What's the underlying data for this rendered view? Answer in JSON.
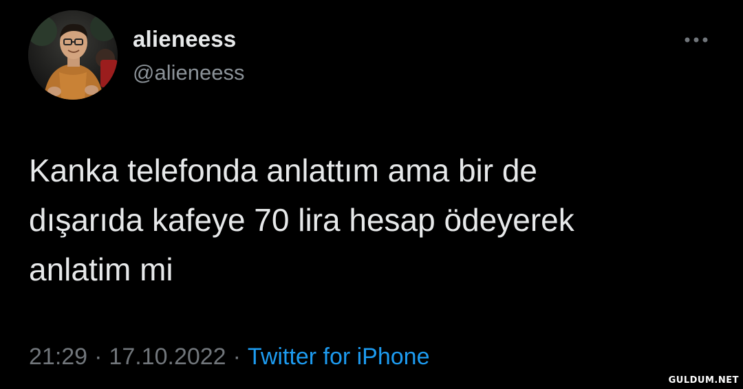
{
  "tweet": {
    "display_name": "alieneess",
    "handle": "@alieneess",
    "text": "Kanka telefonda anlattım ama bir de\ndışarıda kafeye 70 lira hesap ödeyerek\nanlatim mi",
    "time": "21:29",
    "date": "17.10.2022",
    "separator": "·",
    "source": "Twitter for iPhone",
    "more_icon": "more-horizontal-icon",
    "avatar_icon": "profile-photo"
  },
  "watermark": {
    "text": "GULDUM.NET"
  },
  "colors": {
    "background": "#000000",
    "primary_text": "#e7e9ea",
    "secondary_text": "#71767b",
    "link": "#1d9bf0"
  }
}
